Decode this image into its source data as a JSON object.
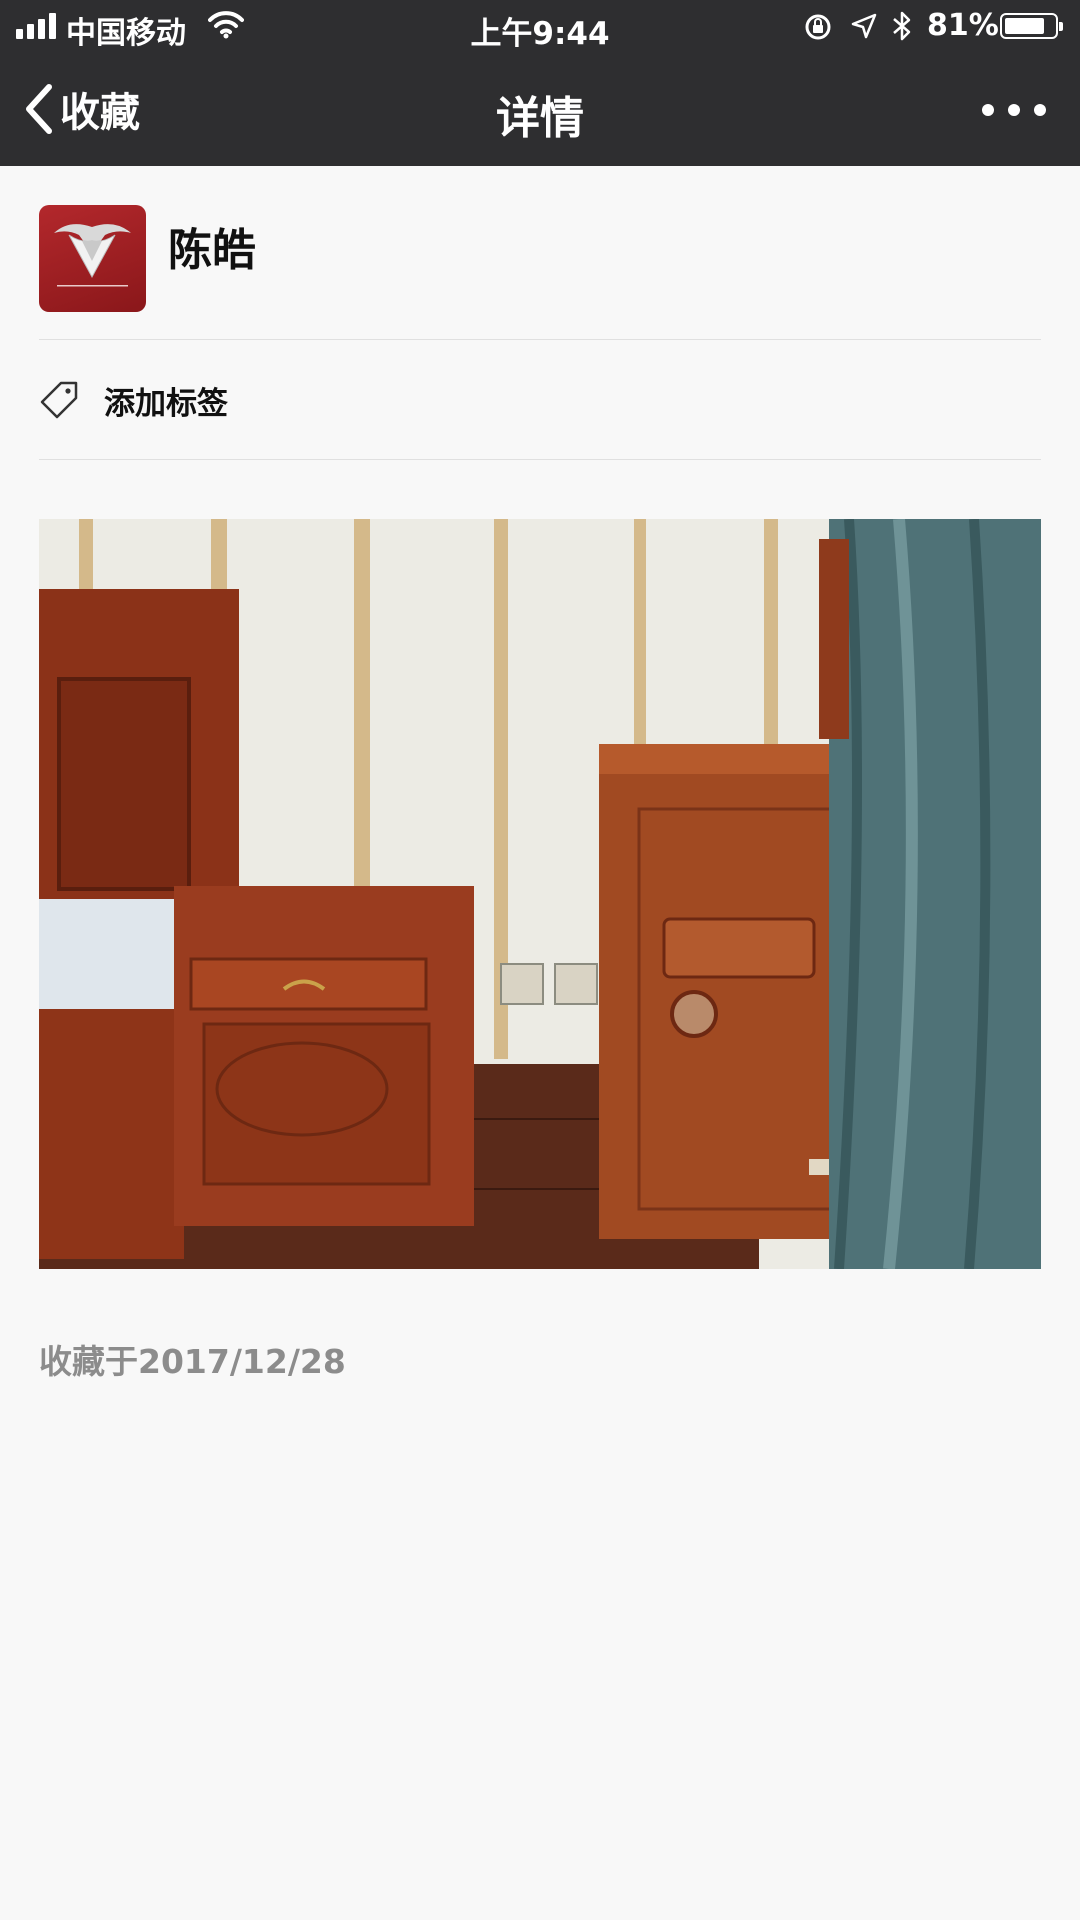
{
  "status_bar": {
    "carrier": "中国移动",
    "time": "上午9:44",
    "battery_percent": "81%",
    "battery_level": 0.81,
    "icons": [
      "signal-icon",
      "wifi-icon",
      "rotation-lock-icon",
      "location-icon",
      "bluetooth-icon",
      "battery-icon"
    ]
  },
  "nav": {
    "back_label": "收藏",
    "title": "详情",
    "more_icon": "more-icon"
  },
  "item": {
    "author": "陈皓",
    "avatar_icon": "brand-logo-avatar",
    "tag_action": "添加标签",
    "tag_icon": "tag-icon",
    "photo_subject": "photo",
    "saved_date": "收藏于2017/12/28"
  },
  "colors": {
    "topbar": "#2e2e30",
    "background": "#f8f8f8",
    "date_text": "#8c8c8c"
  }
}
